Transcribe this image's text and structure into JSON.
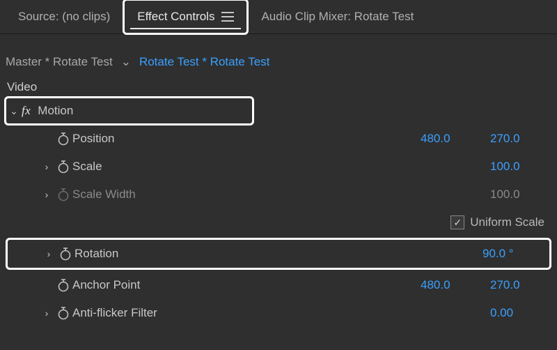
{
  "tabs": {
    "source": "Source: (no clips)",
    "effect_controls": "Effect Controls",
    "audio_mixer": "Audio Clip Mixer: Rotate Test"
  },
  "breadcrumb": {
    "master": "Master * Rotate Test",
    "clip": "Rotate Test * Rotate Test"
  },
  "section": "Video",
  "motion": {
    "label": "Motion",
    "position": {
      "label": "Position",
      "x": "480.0",
      "y": "270.0"
    },
    "scale": {
      "label": "Scale",
      "value": "100.0"
    },
    "scale_width": {
      "label": "Scale Width",
      "value": "100.0"
    },
    "uniform_scale": {
      "label": "Uniform Scale",
      "checked": true
    },
    "rotation": {
      "label": "Rotation",
      "value": "90.0 °"
    },
    "anchor": {
      "label": "Anchor Point",
      "x": "480.0",
      "y": "270.0"
    },
    "anti_flicker": {
      "label": "Anti-flicker Filter",
      "value": "0.00"
    }
  }
}
